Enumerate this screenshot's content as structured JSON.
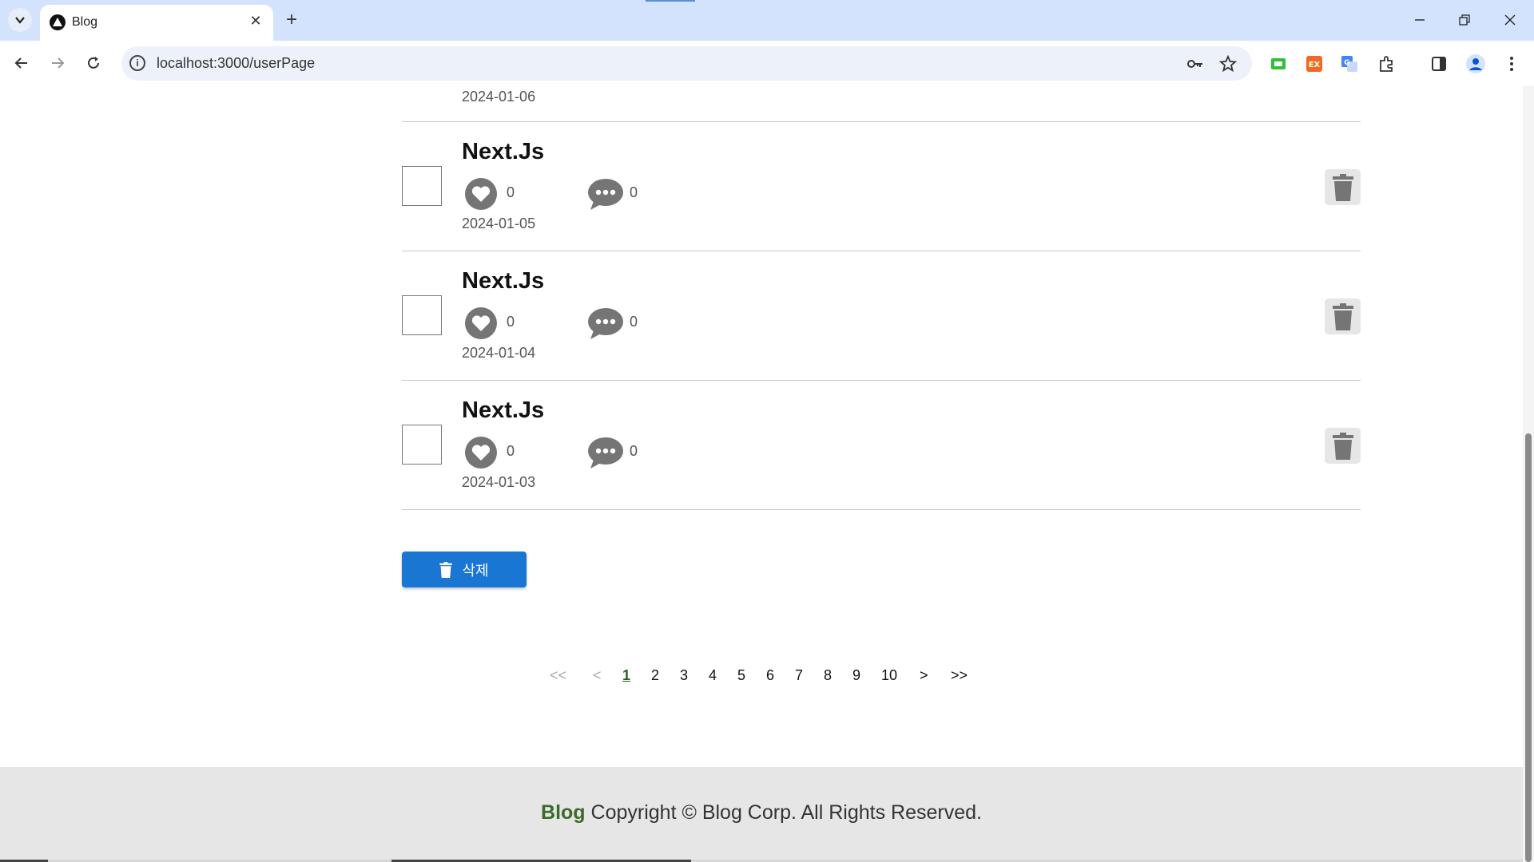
{
  "browser": {
    "tab_title": "Blog",
    "url": "localhost:3000/userPage",
    "icons": {
      "tab_search": "chevron-down-icon",
      "favicon": "triangle-logo-icon",
      "close_tab": "close-icon",
      "new_tab": "plus-icon",
      "minimize": "minimize-icon",
      "restore": "restore-icon",
      "close_window": "close-icon",
      "back": "arrow-left-icon",
      "forward": "arrow-right-icon",
      "reload": "reload-icon",
      "site_info": "info-icon",
      "password": "key-icon",
      "bookmark": "star-icon",
      "extensions": [
        "green-extension-icon",
        "ex-extension-icon",
        "translate-icon",
        "puzzle-icon"
      ],
      "side_panel": "side-panel-icon",
      "profile": "profile-avatar-icon",
      "menu": "more-vert-icon"
    }
  },
  "posts": {
    "previous_date": "2024-01-06",
    "items": [
      {
        "title": "Next.Js",
        "likes": "0",
        "comments": "0",
        "date": "2024-01-05"
      },
      {
        "title": "Next.Js",
        "likes": "0",
        "comments": "0",
        "date": "2024-01-04"
      },
      {
        "title": "Next.Js",
        "likes": "0",
        "comments": "0",
        "date": "2024-01-03"
      }
    ]
  },
  "actions": {
    "bulk_delete_label": "삭제"
  },
  "pagination": {
    "first": "<<",
    "prev": "<",
    "pages": [
      "1",
      "2",
      "3",
      "4",
      "5",
      "6",
      "7",
      "8",
      "9",
      "10"
    ],
    "current": "1",
    "next": ">",
    "last": ">>"
  },
  "footer": {
    "brand": "Blog",
    "text": "Copyright © Blog Corp. All Rights Reserved."
  },
  "colors": {
    "primary_button": "#1976d2",
    "footer_brand": "#3c6a2a",
    "icon_gray": "#757575",
    "tab_bar": "#d3e3fd"
  }
}
